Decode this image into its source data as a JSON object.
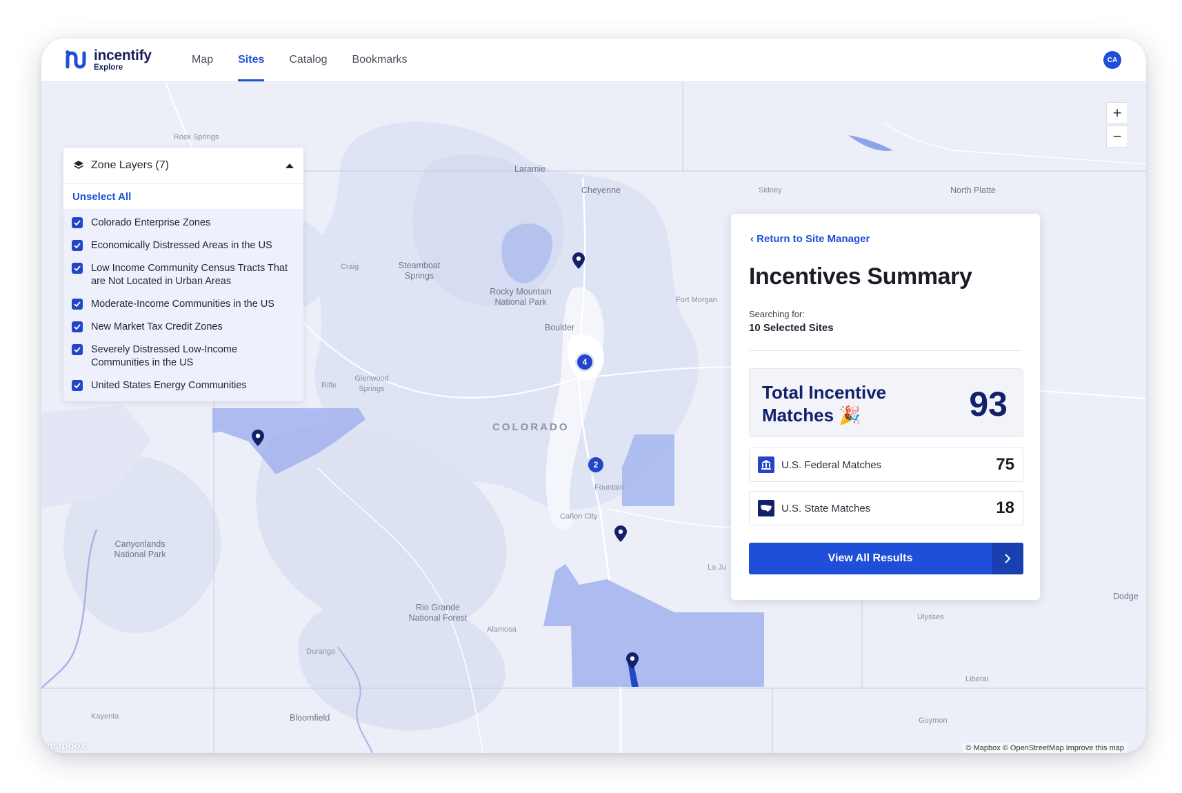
{
  "brand": {
    "name": "incentify",
    "sub": "Explore"
  },
  "nav": {
    "tabs": [
      {
        "label": "Map"
      },
      {
        "label": "Sites"
      },
      {
        "label": "Catalog"
      },
      {
        "label": "Bookmarks"
      }
    ],
    "active": "Sites"
  },
  "user": {
    "initials": "CA"
  },
  "layers": {
    "title": "Zone Layers (7)",
    "unselect_all": "Unselect All",
    "items": [
      {
        "label": "Colorado Enterprise Zones"
      },
      {
        "label": "Economically Distressed Areas in the US"
      },
      {
        "label": "Low Income Community Census Tracts That are Not Located in Urban Areas"
      },
      {
        "label": "Moderate-Income Communities in the US"
      },
      {
        "label": "New Market Tax Credit Zones"
      },
      {
        "label": "Severely Distressed Low-Income Communities in the US"
      },
      {
        "label": "United States Energy Communities"
      }
    ]
  },
  "summary": {
    "back_link": "Return to Site Manager",
    "title": "Incentives Summary",
    "searching_label": "Searching for:",
    "searching_value": "10 Selected Sites",
    "total_label": "Total Incentive Matches 🎉",
    "total_value": "93",
    "federal_label": "U.S. Federal Matches",
    "federal_value": "75",
    "state_label": "U.S. State Matches",
    "state_value": "18",
    "view_all": "View All Results"
  },
  "map": {
    "labels": {
      "rock_springs": "Rock Springs",
      "laramie": "Laramie",
      "cheyenne": "Cheyenne",
      "sidney": "Sidney",
      "north_platte": "North Platte",
      "craig": "Craig",
      "steamboat": "Steamboat Springs",
      "rocky_mountain": "Rocky Mountain National Park",
      "fort_morgan": "Fort Morgan",
      "boulder": "Boulder",
      "rifle": "Rifle",
      "glenwood": "Glenwood Springs",
      "colorado": "COLORADO",
      "fountain": "Fountain",
      "canon_city": "Cañon City",
      "canyonlands": "Canyonlands National Park",
      "la_junta": "La Ju",
      "dodge": "Dodge",
      "ulysses": "Ulysses",
      "rio_grande": "Rio Grande National Forest",
      "alamosa": "Alamosa",
      "durango": "Durango",
      "liberal": "Liberal",
      "kayenta": "Kayenta",
      "bloomfield": "Bloomfield",
      "guymon": "Guymon"
    },
    "clusters": [
      "4",
      "2"
    ],
    "attribution": "© Mapbox © OpenStreetMap Improve this map",
    "mapbox_logo": "mapbox",
    "zoom_in": "+",
    "zoom_out": "−"
  },
  "colors": {
    "accent": "#1f4fd8",
    "navy": "#13206a",
    "zone": "#a9b8ee"
  }
}
